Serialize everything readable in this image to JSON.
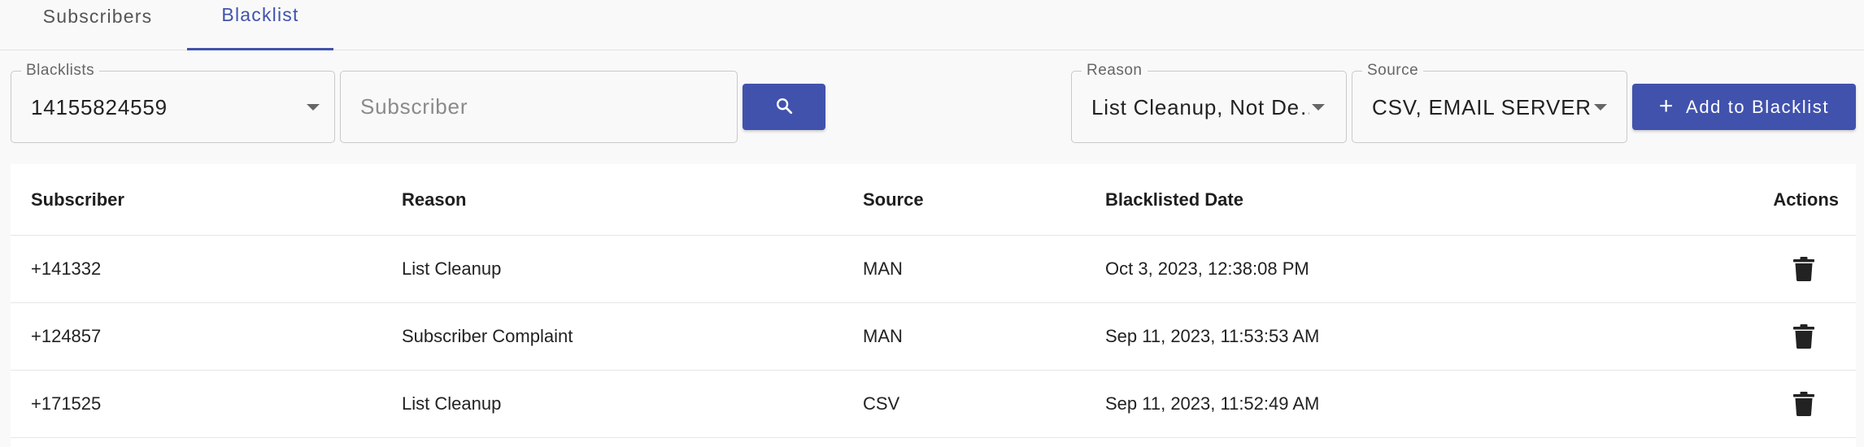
{
  "tabs": [
    {
      "label": "Subscribers",
      "active": false
    },
    {
      "label": "Blacklist",
      "active": true
    }
  ],
  "filters": {
    "blacklists": {
      "label": "Blacklists",
      "value": "14155824559"
    },
    "subscriber": {
      "placeholder": "Subscriber",
      "value": ""
    },
    "reason": {
      "label": "Reason",
      "value": "List Cleanup, Not De…"
    },
    "source": {
      "label": "Source",
      "value": "CSV, EMAIL SERVER,…"
    },
    "search_icon": "search-icon",
    "add_button": {
      "label": "Add to Blacklist",
      "icon": "plus-icon"
    }
  },
  "table": {
    "columns": [
      "Subscriber",
      "Reason",
      "Source",
      "Blacklisted Date",
      "Actions"
    ],
    "rows": [
      {
        "subscriber": "+141332",
        "reason": "List Cleanup",
        "source": "MAN",
        "date": "Oct 3, 2023, 12:38:08 PM",
        "action_icon": "trash-icon"
      },
      {
        "subscriber": "+124857",
        "reason": "Subscriber Complaint",
        "source": "MAN",
        "date": "Sep 11, 2023, 11:53:53 AM",
        "action_icon": "trash-icon"
      },
      {
        "subscriber": "+171525",
        "reason": "List Cleanup",
        "source": "CSV",
        "date": "Sep 11, 2023, 11:52:49 AM",
        "action_icon": "trash-icon"
      }
    ]
  },
  "colors": {
    "accent": "#4152ad",
    "background": "#f9f9f9",
    "table_background": "#ffffff"
  }
}
